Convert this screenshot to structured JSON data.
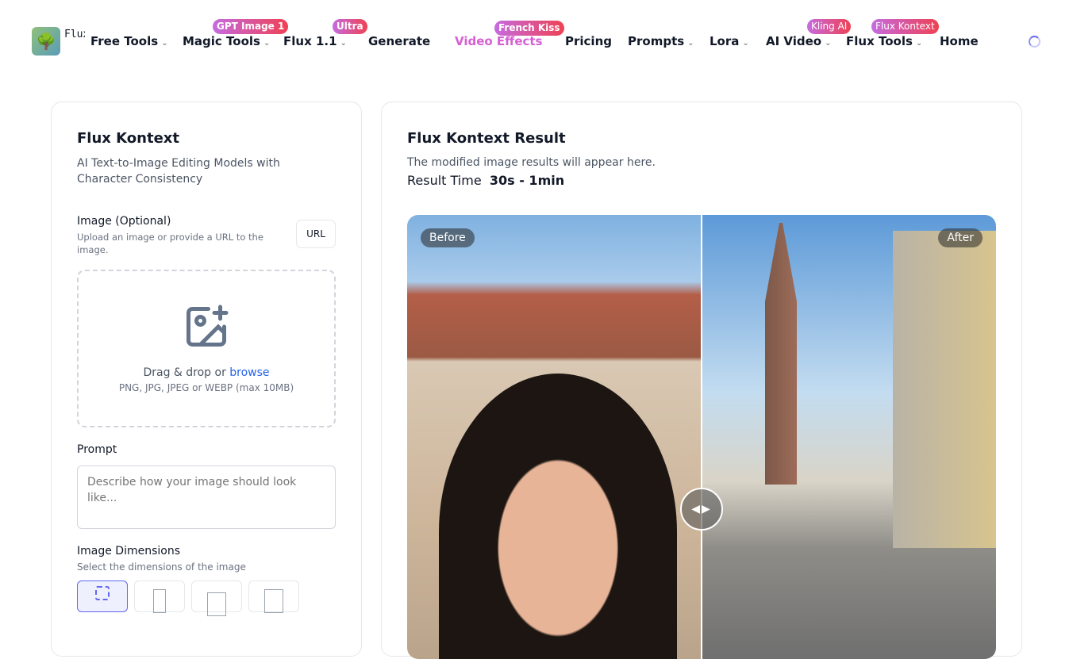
{
  "nav": {
    "logo_text": "Flux AI",
    "items": [
      {
        "label": "Free Tools",
        "dropdown": true
      },
      {
        "label": "Magic Tools",
        "dropdown": true,
        "badge": "GPT Image 1"
      },
      {
        "label": "Flux 1.1",
        "dropdown": true,
        "badge": "Ultra"
      },
      {
        "label": "Generate"
      },
      {
        "label": "Video Effects",
        "badge": "French Kiss"
      },
      {
        "label": "Pricing"
      },
      {
        "label": "Prompts",
        "dropdown": true
      },
      {
        "label": "Lora",
        "dropdown": true
      },
      {
        "label": "AI Video",
        "dropdown": true,
        "badge": "Kling AI"
      },
      {
        "label": "Flux Tools",
        "dropdown": true,
        "badge": "Flux Kontext"
      },
      {
        "label": "Home"
      }
    ]
  },
  "left": {
    "title": "Flux Kontext",
    "subtitle": "AI Text-to-Image Editing Models with Character Consistency",
    "image_label": "Image (Optional)",
    "image_help": "Upload an image or provide a URL to the image.",
    "url_button": "URL",
    "drop_text": "Drag & drop or ",
    "browse": "browse",
    "drop_formats": "PNG, JPG, JPEG or WEBP (max 10MB)",
    "prompt_label": "Prompt",
    "prompt_placeholder": "Describe how your image should look like...",
    "dim_label": "Image Dimensions",
    "dim_help": "Select the dimensions of the image"
  },
  "right": {
    "title": "Flux Kontext Result",
    "desc": "The modified image results will appear here.",
    "time_label": "Result Time",
    "time_value": "30s - 1min",
    "before": "Before",
    "after": "After"
  },
  "colors": {
    "accent": "#6366f1",
    "video_effects": "#d946ef",
    "link": "#2563eb"
  }
}
